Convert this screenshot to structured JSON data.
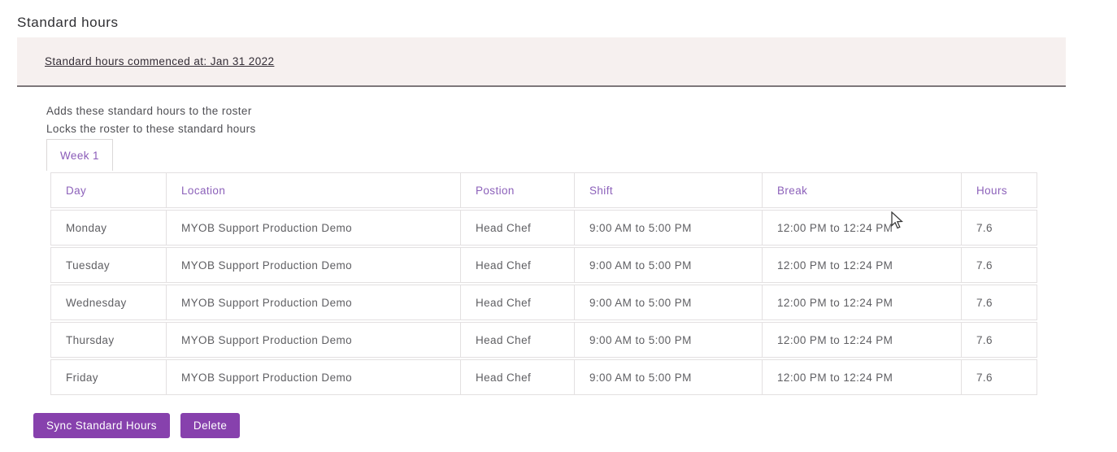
{
  "page": {
    "title": "Standard hours"
  },
  "banner": {
    "link_text": "Standard hours commenced at: Jan 31 2022"
  },
  "description": {
    "line1": "Adds these standard hours to the roster",
    "line2": "Locks the roster to these standard hours"
  },
  "tabs": [
    {
      "label": "Week 1",
      "active": true
    }
  ],
  "table": {
    "columns": [
      "Day",
      "Location",
      "Postion",
      "Shift",
      "Break",
      "Hours"
    ],
    "rows": [
      [
        "Monday",
        "MYOB Support Production Demo",
        "Head Chef",
        "9:00 AM to 5:00 PM",
        "12:00 PM to 12:24 PM",
        "7.6"
      ],
      [
        "Tuesday",
        "MYOB Support Production Demo",
        "Head Chef",
        "9:00 AM to 5:00 PM",
        "12:00 PM to 12:24 PM",
        "7.6"
      ],
      [
        "Wednesday",
        "MYOB Support Production Demo",
        "Head Chef",
        "9:00 AM to 5:00 PM",
        "12:00 PM to 12:24 PM",
        "7.6"
      ],
      [
        "Thursday",
        "MYOB Support Production Demo",
        "Head Chef",
        "9:00 AM to 5:00 PM",
        "12:00 PM to 12:24 PM",
        "7.6"
      ],
      [
        "Friday",
        "MYOB Support Production Demo",
        "Head Chef",
        "9:00 AM to 5:00 PM",
        "12:00 PM to 12:24 PM",
        "7.6"
      ]
    ]
  },
  "actions": {
    "sync_label": "Sync Standard Hours",
    "delete_label": "Delete"
  },
  "icons": {
    "cursor": "arrow-pointer-icon"
  },
  "colors": {
    "accent_purple": "#8741ad",
    "table_header_purple": "#8c61ba",
    "banner_bg": "#f6f0ef",
    "banner_border": "#7d777a",
    "table_border": "#e3e0e1",
    "title_text": "#2f2f33",
    "body_text": "#4f4f54"
  }
}
